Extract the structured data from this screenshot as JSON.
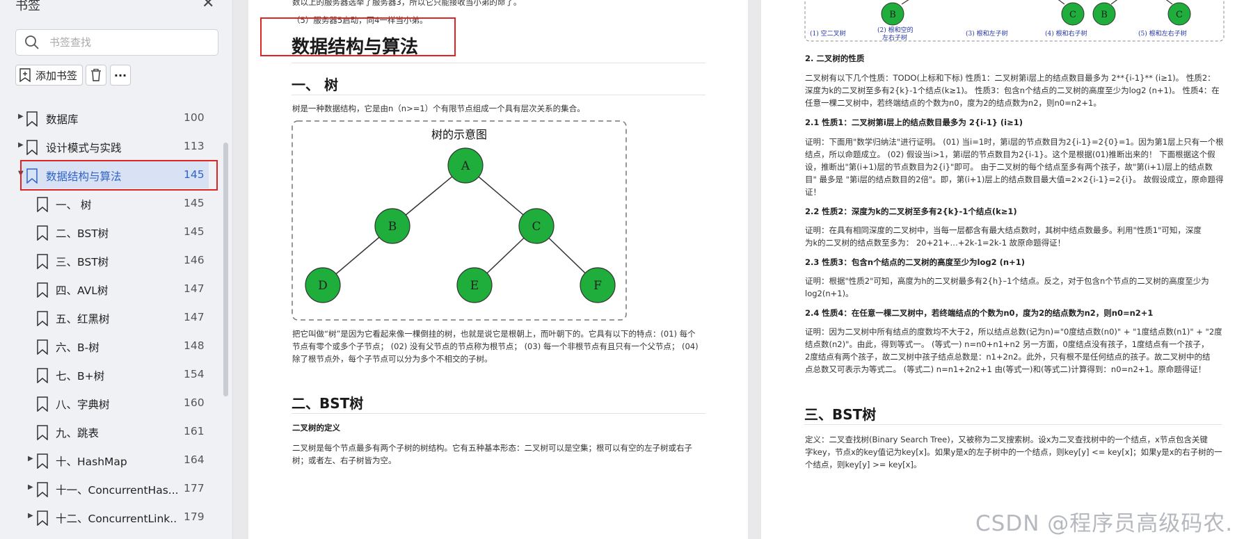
{
  "sidebar": {
    "title": "书签",
    "search_placeholder": "书签查找",
    "add_label": "添加书签",
    "items": [
      {
        "label": "数据库",
        "page": "100",
        "level": 0,
        "expandable": true
      },
      {
        "label": "设计模式与实践",
        "page": "113",
        "level": 0,
        "expandable": true
      },
      {
        "label": "数据结构与算法",
        "page": "145",
        "level": 0,
        "expandable": true,
        "expanded": true,
        "active": true
      },
      {
        "label": "一、 树",
        "page": "145",
        "level": 1
      },
      {
        "label": "二、BST树",
        "page": "145",
        "level": 1
      },
      {
        "label": "三、BST树",
        "page": "146",
        "level": 1
      },
      {
        "label": "四、AVL树",
        "page": "147",
        "level": 1
      },
      {
        "label": "五、红黑树",
        "page": "147",
        "level": 1
      },
      {
        "label": "六、B-树",
        "page": "148",
        "level": 1
      },
      {
        "label": "七、B+树",
        "page": "154",
        "level": 1
      },
      {
        "label": "八、字典树",
        "page": "160",
        "level": 1
      },
      {
        "label": "九、跳表",
        "page": "161",
        "level": 1
      },
      {
        "label": "十、HashMap",
        "page": "164",
        "level": 1,
        "expandable": true
      },
      {
        "label": "十一、ConcurrentHas...",
        "page": "177",
        "level": 1,
        "expandable": true
      },
      {
        "label": "十二、ConcurrentLink...",
        "page": "179",
        "level": 1,
        "expandable": true
      }
    ]
  },
  "page1": {
    "top_line1": "数以上的服务器选举了服务器3，所以它只能接收当小弟的命了。",
    "top_line2": "（5）服务器5启动，同4一样当小弟。",
    "title": "数据结构与算法",
    "h_tree": "一、 树",
    "tree_intro": "树是一种数据结构，它是由n（n>=1）个有限节点组成一个具有层次关系的集合。",
    "diagram_title": "树的示意图",
    "nodes": [
      "A",
      "B",
      "C",
      "D",
      "E",
      "F"
    ],
    "tree_desc": [
      "把它叫做“树”是因为它看起来像一棵倒挂的树，也就是说它是根朝上，而叶朝下的。它具有以下的特点：(01) 每个",
      "节点有零个或多个子节点； (02) 没有父节点的节点称为根节点； (03) 每一个非根节点有且只有一个父节点； (04)",
      "除了根节点外，每个子节点可以分为多个不相交的子树。"
    ],
    "h_bst": "二、BST树",
    "bst_def_title": "二叉树的定义",
    "bst_def": [
      "二叉树是每个节点最多有两个子树的树结构。它有五种基本形态：二叉树可以是空集；根可以有空的左子树或右子",
      "树；或者左、右子树皆为空。"
    ]
  },
  "page2": {
    "fig_labels": [
      "(1) 空二叉树",
      "(2) 根和空的",
      "左右子树",
      "(3) 根和左子树",
      "(4) 根和右子树",
      "(5) 根和左右子树"
    ],
    "fig_nodes": [
      "B",
      "C",
      "B",
      "C"
    ],
    "sec_props": "2. 二叉树的性质",
    "props_text": [
      "二叉树有以下几个性质：TODO(上标和下标) 性质1：二叉树第i层上的结点数目最多为 2**{i-1}** (i≥1)。 性质2：",
      "深度为k的二叉树至多有2{k}-1个结点(k≥1)。 性质3：包含n个结点的二叉树的高度至少为log2 (n+1)。 性质4：在",
      "任意一棵二叉树中，若终端结点的个数为n0，度为2的结点数为n2，则n0=n2+1。"
    ],
    "s21_title": "2.1 性质1：二叉树第i层上的结点数目最多为 2{i-1} (i≥1)",
    "s21_text": [
      "证明：下面用\"数学归纳法\"进行证明。 (01) 当i=1时，第i层的节点数目为2{i-1}=2{0}=1。因为第1层上只有一个根",
      "结点，所以命题成立。 (02) 假设当i>1，第i层的节点数目为2{i-1}。这个是根据(01)推断出来的！ 下面根据这个假",
      "设，推断出\"第(i+1)层的节点数目为2{i}\"即可。 由于二叉树的每个结点至多有两个孩子，故\"第(i+1)层上的结点数",
      "目\" 最多是 \"第i层的结点数目的2倍\"。即，第(i+1)层上的结点数目最大值=2×2{i-1}=2{i}。 故假设成立，原命题得",
      "证！"
    ],
    "s22_title": "2.2 性质2：深度为k的二叉树至多有2{k}-1个结点(k≥1)",
    "s22_text": [
      "证明：在具有相同深度的二叉树中，当每一层都含有最大结点数时，其树中结点数最多。利用\"性质1\"可知，深度",
      "为k的二叉树的结点数至多为： 20+21+…+2k-1=2k-1 故原命题得证！"
    ],
    "s23_title": "2.3 性质3：包含n个结点的二叉树的高度至少为log2 (n+1)",
    "s23_text": [
      "证明：根据\"性质2\"可知，高度为h的二叉树最多有2{h}–1个结点。反之，对于包含n个节点的二叉树的高度至少为",
      "log2(n+1)。"
    ],
    "s24_title": "2.4 性质4：在任意一棵二叉树中，若终端结点的个数为n0，度为2的结点数为n2，则n0=n2+1",
    "s24_text": [
      "证明：因为二叉树中所有结点的度数均不大于2，所以结点总数(记为n)=\"0度结点数(n0)\" + \"1度结点数(n1)\" + \"2度",
      "结点数(n2)\"。由此，得到等式一。 (等式一) n=n0+n1+n2 另一方面，0度结点没有孩子，1度结点有一个孩子，",
      "2度结点有两个孩子，故二叉树中孩子结点总数是：n1+2n2。此外，只有根不是任何结点的孩子。故二叉树中的结",
      "点总数又可表示为等式二。 (等式二) n=n1+2n2+1 由(等式一)和(等式二)计算得到：n0=n2+1。原命题得证！"
    ],
    "h_bst": "三、BST树",
    "bst_def": [
      "定义：二叉查找树(Binary Search Tree)，又被称为二叉搜索树。设x为二叉查找树中的一个结点，x节点包含关键",
      "字key，节点x的key值记为key[x]。如果y是x的左子树中的一个结点，则key[y] <= key[x]；如果y是x的右子树的一",
      "个结点，则key[y] >= key[x]。"
    ]
  },
  "watermark": "CSDN @程序员高级码农.",
  "colors": {
    "accent": "#2f64c8",
    "highlight_box": "#e02424",
    "tree_node": "#1fae3b",
    "selected_bg": "#d8e2f4"
  }
}
